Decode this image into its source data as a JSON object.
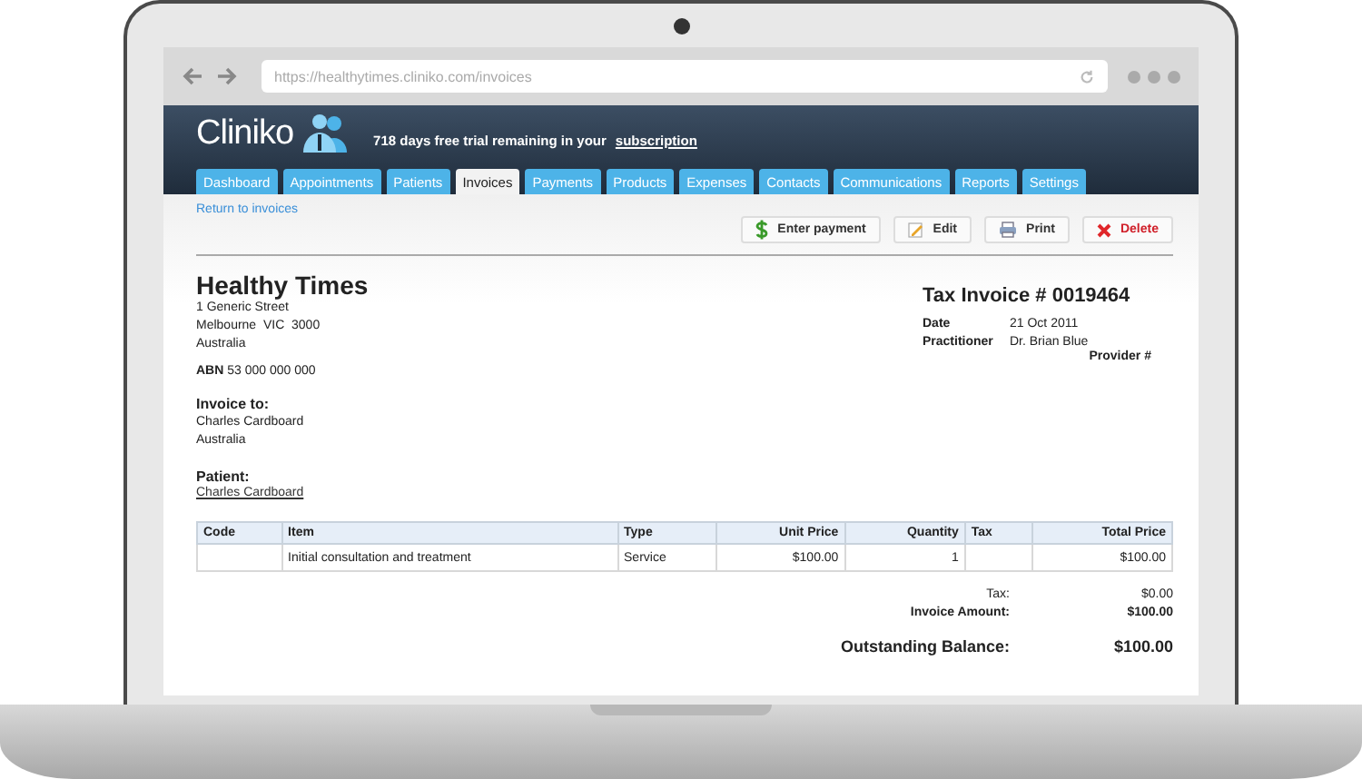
{
  "browser": {
    "url": "https://healthytimes.cliniko.com/invoices"
  },
  "header": {
    "logo": "Cliniko",
    "trial_text": "718 days free trial remaining in your",
    "trial_link": "subscription"
  },
  "tabs": [
    {
      "label": "Dashboard",
      "selected": false
    },
    {
      "label": "Appointments",
      "selected": false
    },
    {
      "label": "Patients",
      "selected": false
    },
    {
      "label": "Invoices",
      "selected": true
    },
    {
      "label": "Payments",
      "selected": false
    },
    {
      "label": "Products",
      "selected": false
    },
    {
      "label": "Expenses",
      "selected": false
    },
    {
      "label": "Contacts",
      "selected": false
    },
    {
      "label": "Communications",
      "selected": false
    },
    {
      "label": "Reports",
      "selected": false
    },
    {
      "label": "Settings",
      "selected": false
    }
  ],
  "return_link": "Return to invoices",
  "actions": [
    {
      "label": "Enter payment",
      "kind": "payment"
    },
    {
      "label": "Edit",
      "kind": "edit"
    },
    {
      "label": "Print",
      "kind": "print"
    },
    {
      "label": "Delete",
      "kind": "delete"
    }
  ],
  "business": {
    "name": "Healthy Times",
    "address_lines": [
      "1 Generic Street",
      "Melbourne  VIC  3000",
      "Australia"
    ],
    "abn_label": "ABN",
    "abn_value": "53 000 000 000"
  },
  "invoice": {
    "title": "Tax Invoice # 0019464",
    "fields": [
      {
        "label": "Date",
        "value": "21 Oct 2011"
      },
      {
        "label": "Practitioner",
        "value": "Dr. Brian Blue"
      }
    ],
    "provider_label": "Provider #"
  },
  "invoice_to": {
    "heading": "Invoice to:",
    "lines": [
      "Charles Cardboard",
      "Australia"
    ]
  },
  "patient": {
    "heading": "Patient:",
    "link": "Charles Cardboard"
  },
  "table": {
    "columns": [
      "Code",
      "Item",
      "Type",
      "Unit Price",
      "Quantity",
      "Tax",
      "Total Price"
    ],
    "rows": [
      [
        "",
        "Initial consultation and treatment",
        "Service",
        "$100.00",
        "1",
        "",
        "$100.00"
      ]
    ]
  },
  "totals": [
    {
      "label": "Tax:",
      "value": "$0.00",
      "bold": false
    },
    {
      "label": "Invoice Amount:",
      "value": "$100.00",
      "bold": true
    }
  ],
  "balance": {
    "label": "Outstanding Balance:",
    "value": "$100.00"
  }
}
